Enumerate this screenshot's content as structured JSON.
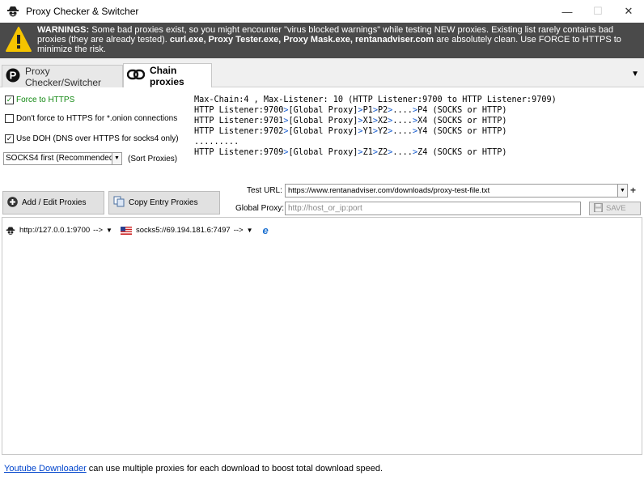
{
  "window": {
    "title": "Proxy Checker & Switcher",
    "icon": "spy-icon",
    "controls": {
      "minimize": "—",
      "maximize": "☐",
      "close": "✕"
    }
  },
  "warning": {
    "label": "WARNINGS:",
    "text1": " Some bad proxies exist, so you might encounter \"virus blocked warnings\" while testing NEW proxies. Existing list rarely contains bad proxies (they are already tested). ",
    "clean_list": "curl.exe, Proxy Tester.exe, Proxy Mask.exe, rentanadviser.com",
    "text2": " are absolutely clean. Use FORCE to HTTPS to minimize the risk."
  },
  "tabs": [
    {
      "label": "Proxy Checker/Switcher",
      "icon": "p-circle-icon",
      "active": false
    },
    {
      "label": "Chain proxies",
      "icon": "chain-icon",
      "active": true
    }
  ],
  "options": {
    "force_https": {
      "label": "Force to HTTPS",
      "checked": true
    },
    "no_force_onion": {
      "label": "Don't force to HTTPS for *.onion connections",
      "checked": false
    },
    "use_doh": {
      "label": "Use DOH (DNS over HTTPS for socks4 only)",
      "checked": true
    },
    "sort_select": {
      "value": "SOCKS4 first (Recommended)",
      "label": "(Sort Proxies)"
    }
  },
  "info": {
    "line0": "Max-Chain:4 , Max-Listener: 10 (HTTP Listener:9700 to HTTP Listener:9709)",
    "lines": [
      {
        "a": "HTTP Listener:9700",
        "b": "[Global Proxy]",
        "c": "P1",
        "d": "P2",
        "e": "....",
        "f": "P4",
        "g": " (SOCKS or HTTP)"
      },
      {
        "a": "HTTP Listener:9701",
        "b": "[Global Proxy]",
        "c": "X1",
        "d": "X2",
        "e": "....",
        "f": "X4",
        "g": " (SOCKS or HTTP)"
      },
      {
        "a": "HTTP Listener:9702",
        "b": "[Global Proxy]",
        "c": "Y1",
        "d": "Y2",
        "e": "....",
        "f": "Y4",
        "g": " (SOCKS or HTTP)"
      }
    ],
    "dots": ".........",
    "last": {
      "a": "HTTP Listener:9709",
      "b": "[Global Proxy]",
      "c": "Z1",
      "d": "Z2",
      "e": "....",
      "f": "Z4",
      "g": " (SOCKS or HTTP)"
    },
    "arrow": ">"
  },
  "buttons": {
    "add": "Add / Edit Proxies",
    "copy": "Copy Entry Proxies",
    "save": "SAVE"
  },
  "fields": {
    "test_url_label": "Test URL:",
    "test_url_value": "https://www.rentanadviser.com/downloads/proxy-test-file.txt",
    "global_proxy_label": "Global Proxy:",
    "global_proxy_placeholder": "http://host_or_ip:port",
    "plus": "+"
  },
  "chain": {
    "listener": "http://127.0.0.1:9700",
    "arrow1": "-->",
    "proxy": "socks5://69.194.181.6:7497",
    "arrow2": "-->",
    "flag": "us-flag-icon",
    "browser": "ie-icon"
  },
  "footer": {
    "link": "Youtube Downloader",
    "text": " can use multiple proxies for each download to boost total download speed."
  },
  "colors": {
    "warning_bg": "#4a4a4a",
    "chain_blue": "#1a5fd0",
    "force_green": "#118811",
    "link": "#0044cc"
  }
}
